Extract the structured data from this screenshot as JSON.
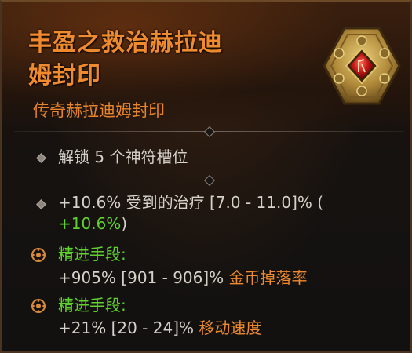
{
  "item": {
    "title_line1": "丰盈之救治赫拉迪",
    "title_line2": "姆封印",
    "subtitle": "传奇赫拉迪姆封印",
    "seal_icon": "hexagon-seal-icon"
  },
  "implicit": {
    "text": "解锁 5 个神符槽位"
  },
  "affix1": {
    "value": "+10.6%",
    "desc": " 受到的治疗 [7.0 - 11.0]% (",
    "bonus": "+10.6%",
    "close": ")"
  },
  "masterwork1": {
    "label": "精进手段:",
    "value": "+905% [901 - 906]% ",
    "stat": "金币掉落率"
  },
  "masterwork2": {
    "label": "精进手段:",
    "value": "+21% [20 - 24]% ",
    "stat": "移动速度"
  },
  "colors": {
    "title": "#f08a2e",
    "green": "#5fd12c",
    "text": "#d6d2ca"
  }
}
